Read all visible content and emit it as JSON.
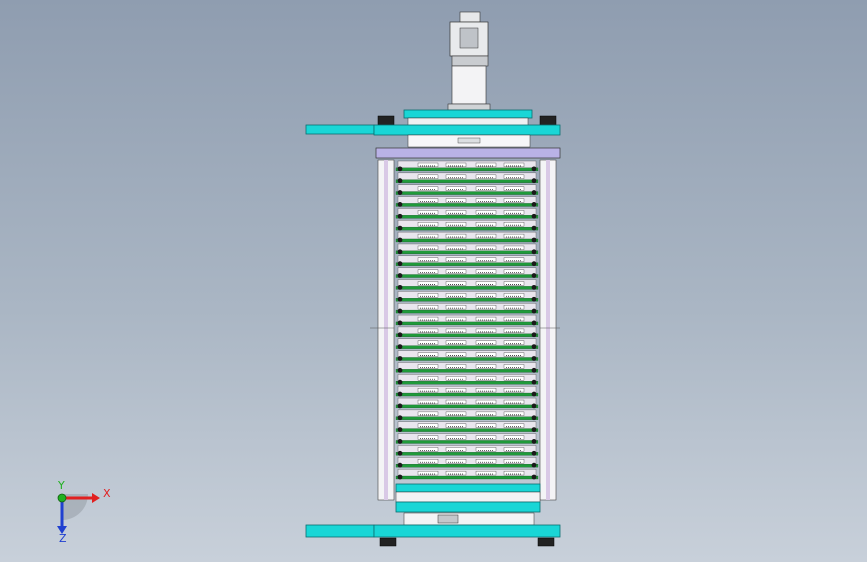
{
  "viewport": {
    "background_top": "#8f9db0",
    "background_bottom": "#c8d0da"
  },
  "model": {
    "name": "stacked-rack-assembly",
    "shelf_count": 27,
    "colors": {
      "frame_cyan": "#19d6d6",
      "frame_dark": "#0a6e70",
      "lavender_plate": "#b9b2e6",
      "pcb_green": "#1f9a3a",
      "post_white": "#f2f2f5",
      "motor_gray": "#d7d9dc",
      "outline": "#2a2a2a"
    }
  },
  "triad": {
    "x_label": "X",
    "y_label": "Y",
    "z_label": "Z",
    "x_color": "#e12020",
    "y_color": "#20b020",
    "z_color": "#2040d0"
  }
}
